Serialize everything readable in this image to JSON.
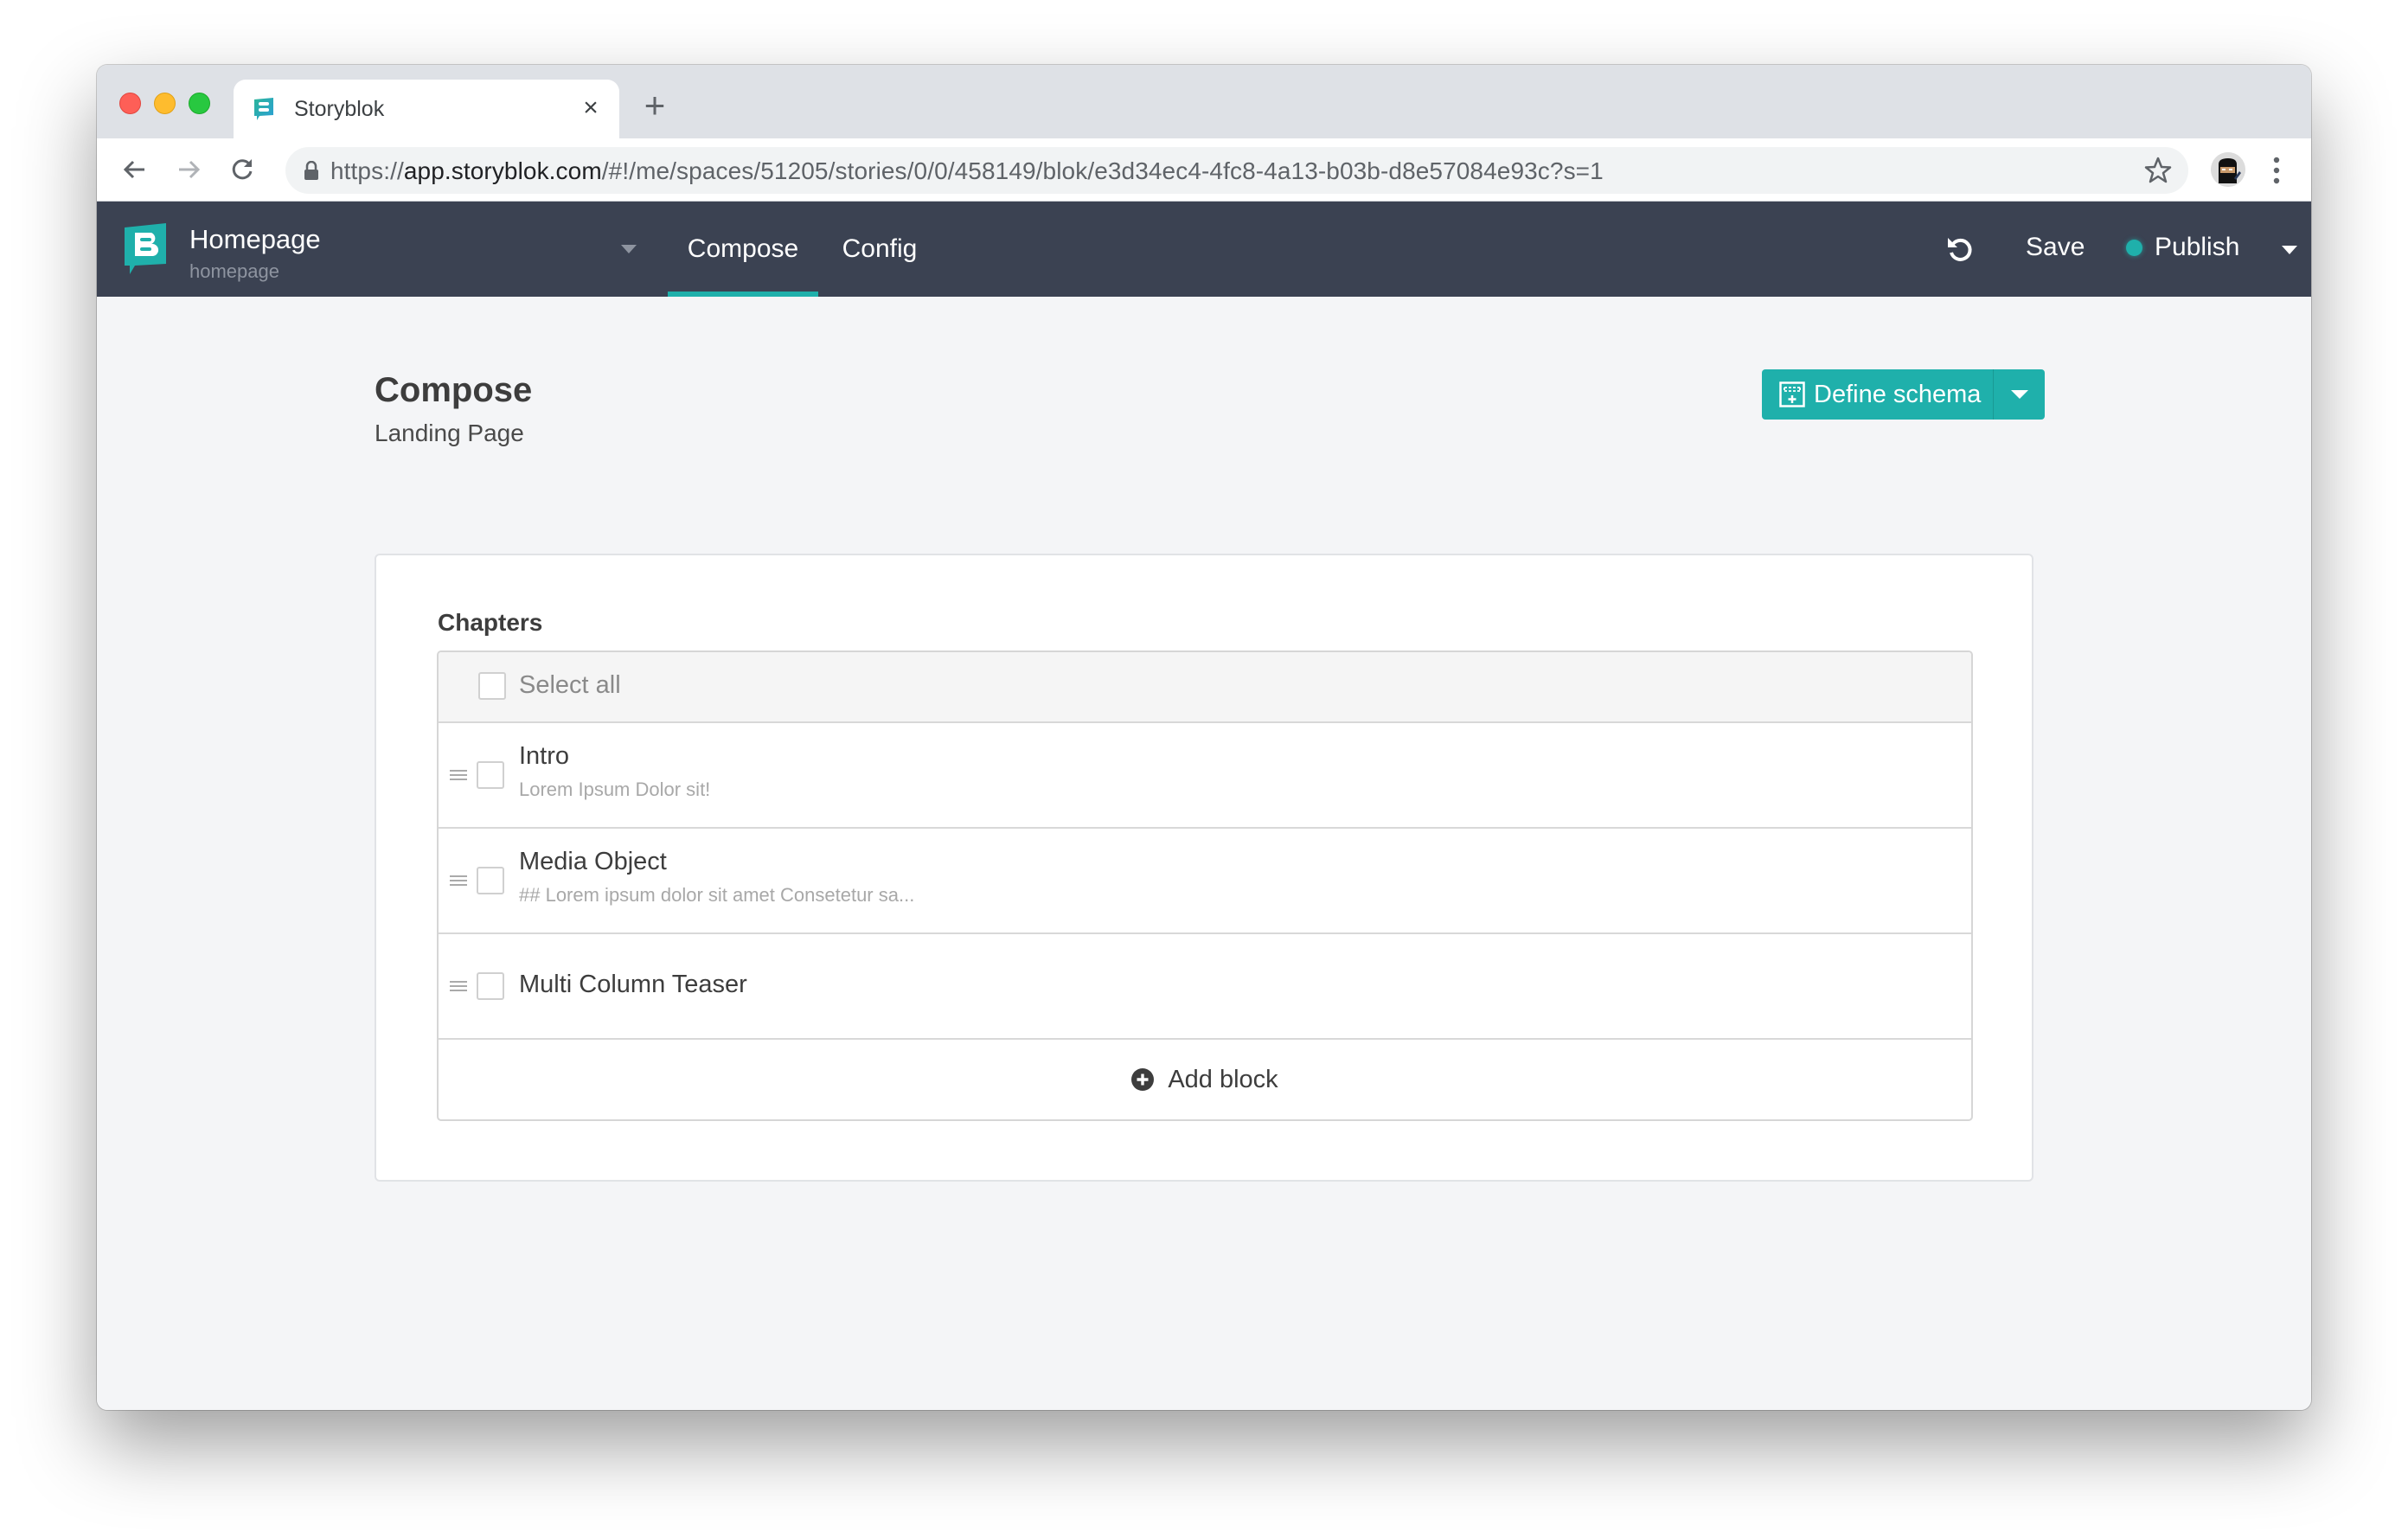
{
  "browser": {
    "tab": {
      "title": "Storyblok",
      "favicon": "storyblok-favicon",
      "close_icon": "close-icon"
    },
    "new_tab_icon": "plus-icon",
    "nav": {
      "back_icon": "arrow-left-icon",
      "forward_icon": "arrow-right-icon",
      "reload_icon": "reload-icon"
    },
    "url": {
      "scheme": "https://",
      "host": "app.storyblok.com",
      "path": "/#!/me/spaces/51205/stories/0/0/458149/blok/e3d34ec4-4fc8-4a13-b03b-d8e57084e93c?s=1"
    },
    "lock_icon": "lock-icon",
    "bookmark_icon": "star-icon",
    "profile_icon": "ninja-avatar",
    "menu_icon": "kebab-menu-icon"
  },
  "appbar": {
    "story_title": "Homepage",
    "story_slug": "homepage",
    "tabs": [
      {
        "label": "Compose",
        "active": true
      },
      {
        "label": "Config",
        "active": false
      }
    ],
    "undo_icon": "undo-icon",
    "save_label": "Save",
    "publish_label": "Publish",
    "publish_status_color": "#1fb0ab"
  },
  "page": {
    "title": "Compose",
    "subtitle": "Landing Page",
    "define_schema_label": "Define schema"
  },
  "field": {
    "label": "Chapters",
    "select_all_label": "Select all",
    "items": [
      {
        "title": "Intro",
        "description": "Lorem Ipsum Dolor sit!"
      },
      {
        "title": "Media Object",
        "description": "## Lorem ipsum dolor sit amet Consetetur sa..."
      },
      {
        "title": "Multi Column Teaser",
        "description": ""
      }
    ],
    "add_block_label": "Add block"
  },
  "colors": {
    "accent": "#1fb0ab",
    "appbar_bg": "#3b4252",
    "content_bg": "#f4f5f7"
  }
}
